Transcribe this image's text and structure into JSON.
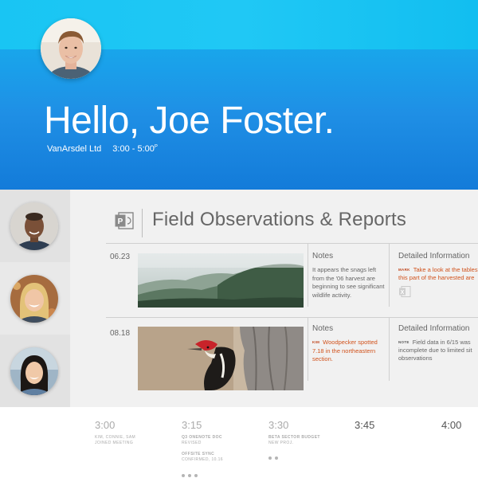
{
  "header": {
    "greeting": "Hello, Joe Foster.",
    "company": "VanArsdel Ltd",
    "time_range": "3:00 - 5:00",
    "time_suffix": "P"
  },
  "sidebar": {
    "people": [
      {
        "name": "attendee-1"
      },
      {
        "name": "attendee-2"
      },
      {
        "name": "attendee-3"
      }
    ]
  },
  "panel": {
    "app_icon": "powerpoint-icon",
    "title": "Field Observations & Reports",
    "columns": {
      "notes": "Notes",
      "details": "Detailed Information"
    },
    "rows": [
      {
        "date": "06.23",
        "photo": "misty-forest-photo",
        "notes": "It appears the snags left from the '06 harvest are beginning to see significant wildlife activity.",
        "detail_tag": "MARK",
        "detail_text_1": "Take a look at the tables",
        "detail_text_2": "this part of the harvested are",
        "detail_icon": "excel-icon"
      },
      {
        "date": "08.18",
        "photo": "woodpecker-photo",
        "notes_tag": "KIM",
        "notes_text": "Woodpecker spotted 7.18 in the northeastern section.",
        "detail_tag": "NOTE",
        "detail_text_1": "Field data in 6/15 was",
        "detail_text_2": "incomplete due to limited sit",
        "detail_text_3": "observations"
      }
    ]
  },
  "timeline": {
    "slots": [
      {
        "time": "3:00",
        "items": [
          {
            "line1": "KIM, CONNIE, SAM",
            "line2": "JOINED MEETING"
          }
        ]
      },
      {
        "time": "3:15",
        "items": [
          {
            "line1": "Q3 ONENOTE DOC",
            "line2": "REVISED"
          },
          {
            "line1": "OFFSITE SYNC",
            "line2": "CONFIRMED, 10.16"
          }
        ]
      },
      {
        "time": "3:30",
        "items": [
          {
            "line1": "BETA SECTOR BUDGET",
            "line2": "NEW PROJ."
          }
        ]
      },
      {
        "time": "3:45",
        "items": []
      },
      {
        "time": "4:00",
        "items": []
      }
    ]
  },
  "colors": {
    "hero_blue": "#1a9ee9",
    "hero_cyan": "#20c8f5",
    "accent_orange": "#d1521c",
    "panel_bg": "#f1f1f1"
  }
}
